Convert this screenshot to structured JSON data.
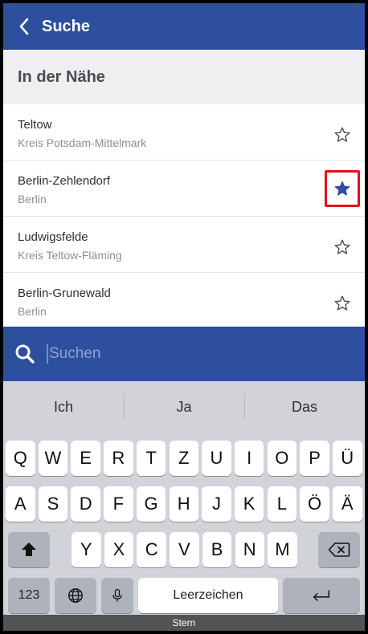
{
  "header": {
    "back_icon": "chevron-left-icon",
    "title": "Suche"
  },
  "section": {
    "title": "In der Nähe"
  },
  "places": [
    {
      "name": "Teltow",
      "region": "Kreis Potsdam-Mittelmark",
      "favorite": false
    },
    {
      "name": "Berlin-Zehlendorf",
      "region": "Berlin",
      "favorite": true
    },
    {
      "name": "Ludwigsfelde",
      "region": "Kreis Teltow-Fläming",
      "favorite": false
    },
    {
      "name": "Berlin-Grunewald",
      "region": "Berlin",
      "favorite": false
    }
  ],
  "search": {
    "placeholder": "Suchen",
    "icon": "search-icon"
  },
  "keyboard": {
    "suggestions": [
      "Ich",
      "Ja",
      "Das"
    ],
    "row1": [
      "Q",
      "W",
      "E",
      "R",
      "T",
      "Z",
      "U",
      "I",
      "O",
      "P",
      "Ü"
    ],
    "row2": [
      "A",
      "S",
      "D",
      "F",
      "G",
      "H",
      "J",
      "K",
      "L",
      "Ö",
      "Ä"
    ],
    "row3": [
      "Y",
      "X",
      "C",
      "V",
      "B",
      "N",
      "M"
    ],
    "numbers_label": "123",
    "space_label": "Leerzeichen",
    "shift_icon": "shift-icon",
    "delete_icon": "backspace-icon",
    "globe_icon": "globe-icon",
    "mic_icon": "microphone-icon",
    "return_icon": "return-icon"
  },
  "caption": {
    "text": "Stern"
  },
  "colors": {
    "brand": "#2d4f9e",
    "highlight": "#e3101a",
    "star_filled": "#2d4f9e"
  }
}
